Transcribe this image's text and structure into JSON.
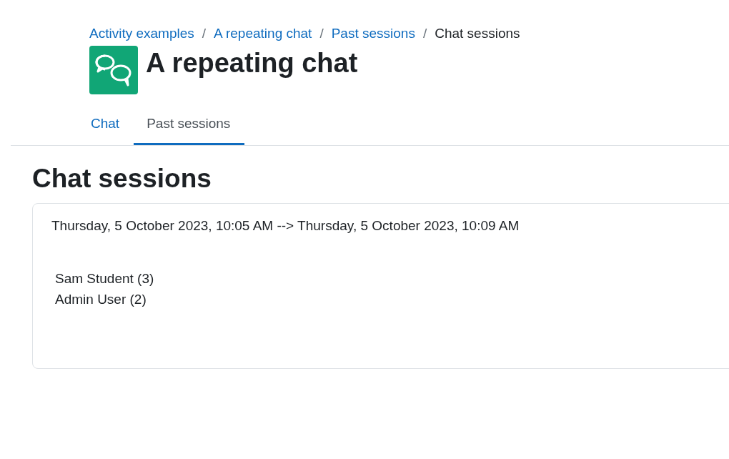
{
  "breadcrumb": {
    "separator": "/",
    "items": [
      {
        "label": "Activity examples",
        "kind": "link"
      },
      {
        "label": "A repeating chat",
        "kind": "link"
      },
      {
        "label": "Past sessions",
        "kind": "link"
      },
      {
        "label": "Chat sessions",
        "kind": "current"
      }
    ]
  },
  "page_title": "A repeating chat",
  "tabs": [
    {
      "label": "Chat",
      "selected": false
    },
    {
      "label": "Past sessions",
      "selected": true
    }
  ],
  "section_heading": "Chat sessions",
  "sessions": [
    {
      "period": "Thursday, 5 October 2023, 10:05 AM --> Thursday, 5 October 2023, 10:09 AM",
      "participants": [
        "Sam Student (3)",
        "Admin User (2)"
      ]
    }
  ]
}
